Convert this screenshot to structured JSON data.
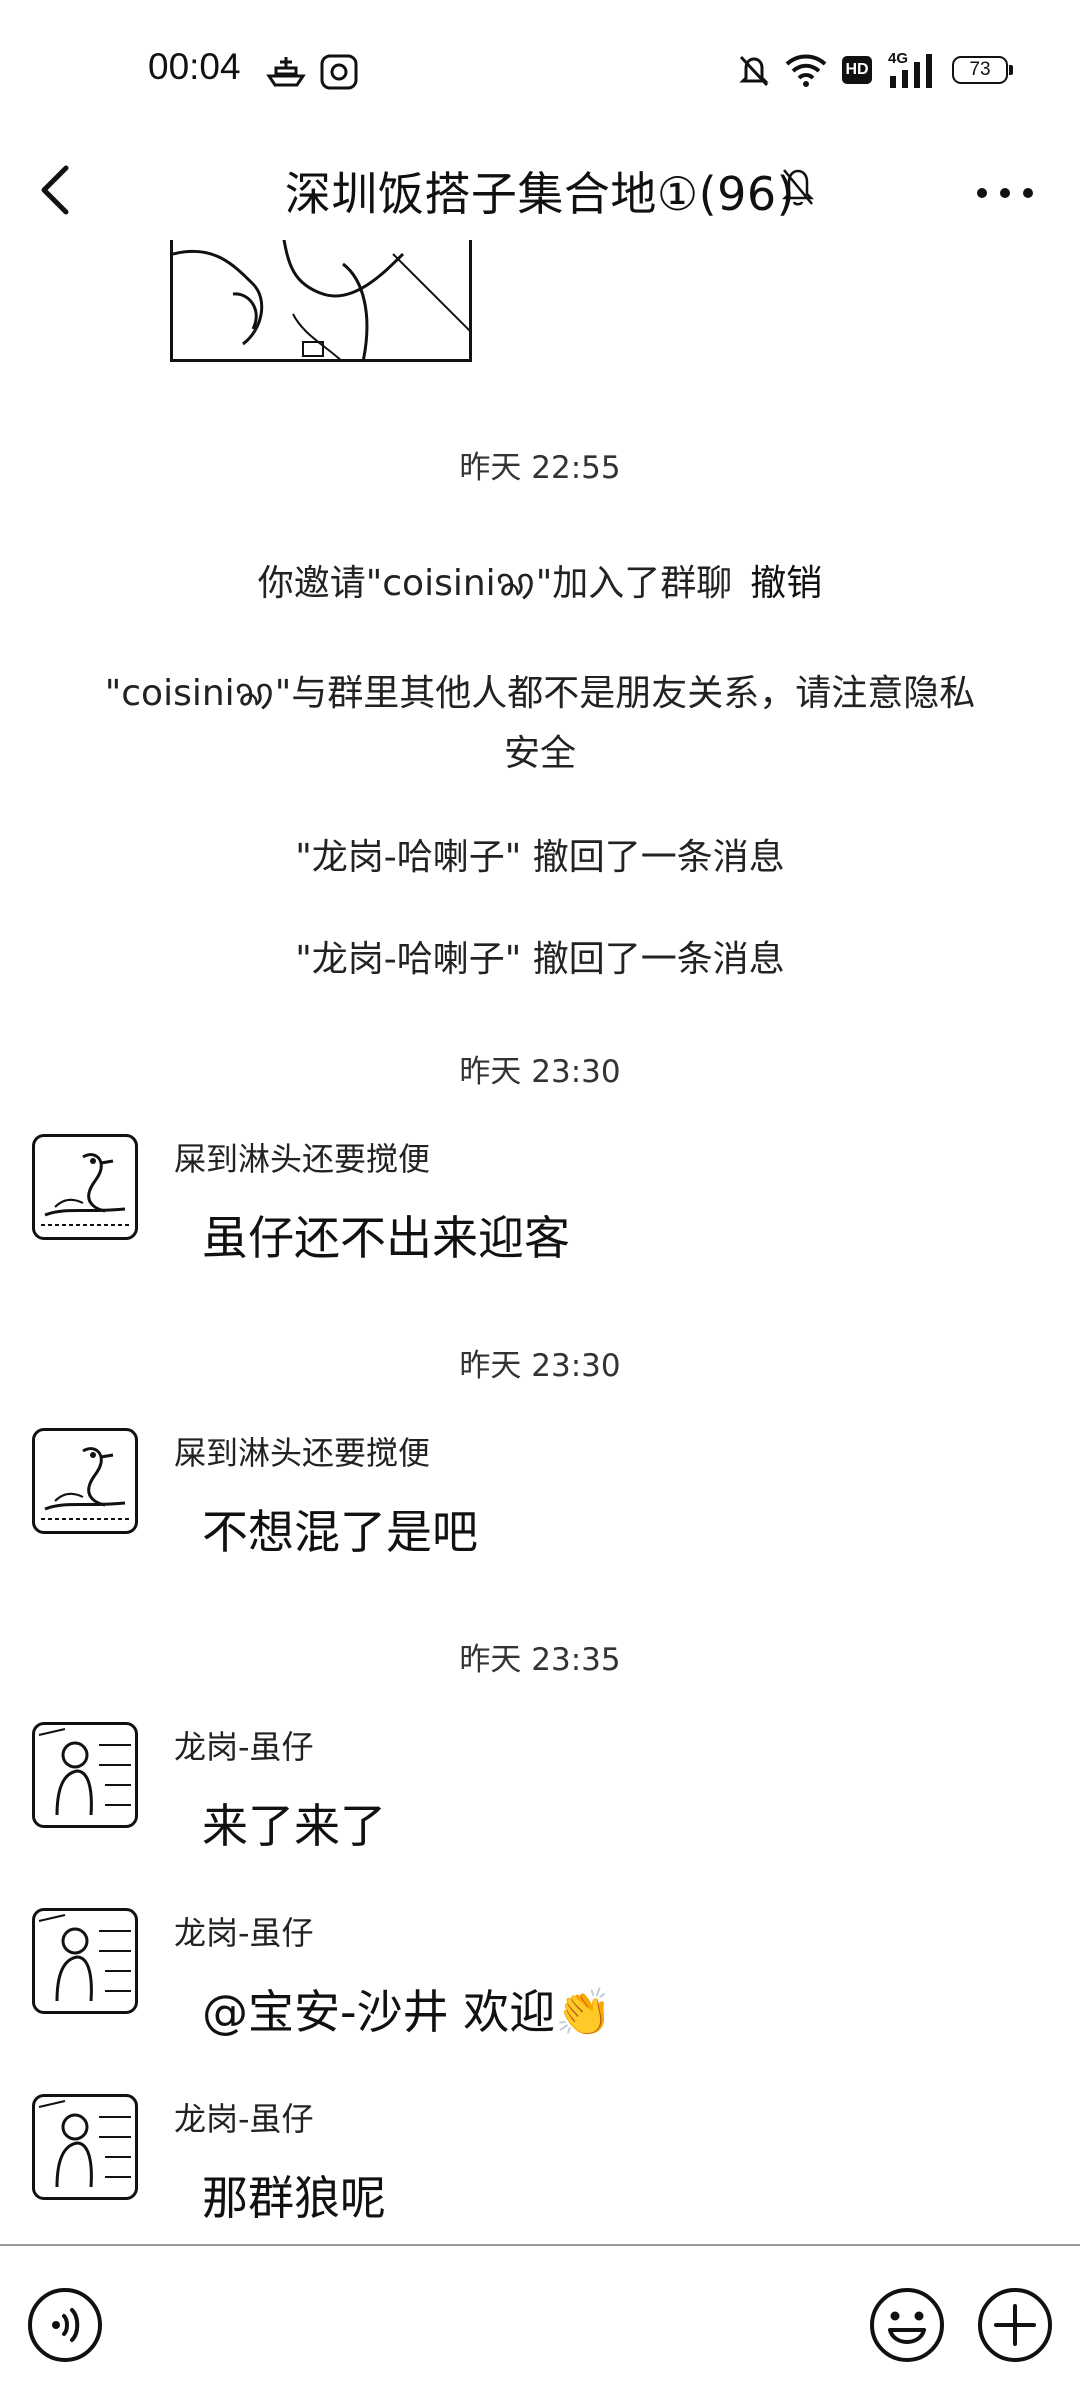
{
  "status_bar": {
    "time": "00:04",
    "battery": "73",
    "icons": [
      "boat-icon",
      "camera-app-icon",
      "mute-bell-icon",
      "wifi-icon",
      "hd-icon",
      "4g-signal-icon",
      "battery-icon"
    ],
    "hd_label": "HD",
    "network_label": "4G"
  },
  "header": {
    "title": "深圳饭搭子集合地①(96)",
    "back_icon": "chevron-left-icon",
    "mute_icon": "bell-off-icon",
    "more_icon": "more-dots-icon"
  },
  "chat": {
    "timestamps": [
      "昨天 22:55",
      "昨天 23:30",
      "昨天 23:30",
      "昨天 23:35"
    ],
    "system": {
      "invite_text": "你邀请\"coisiniꩆ\"加入了群聊",
      "revoke_label": "撤销",
      "privacy_line1": "\"coisiniꩆ\"与群里其他人都不是朋友关系，请注意隐私",
      "privacy_line2": "安全",
      "recall_1": "\"龙岗-哈喇子\" 撤回了一条消息",
      "recall_2": "\"龙岗-哈喇子\" 撤回了一条消息"
    },
    "messages": [
      {
        "sender": "屎到淋头还要搅便",
        "text": "虽仔还不出来迎客"
      },
      {
        "sender": "屎到淋头还要搅便",
        "text": "不想混了是吧"
      },
      {
        "sender": "龙岗-虽仔",
        "text": "来了来了"
      },
      {
        "sender": "龙岗-虽仔",
        "text": "@宝安-沙井  欢迎👏"
      },
      {
        "sender": "龙岗-虽仔",
        "text": "那群狼呢"
      }
    ]
  },
  "input_bar": {
    "voice_icon": "voice-icon",
    "emoji_icon": "emoji-icon",
    "plus_icon": "plus-circle-icon"
  }
}
